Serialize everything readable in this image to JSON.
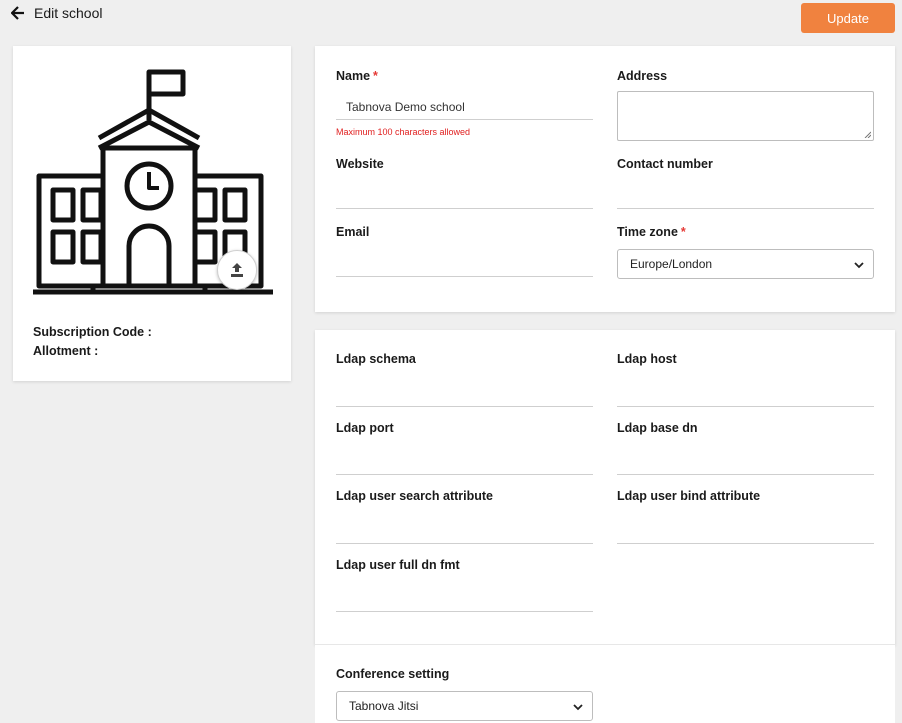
{
  "header": {
    "title": "Edit school",
    "update_label": "Update"
  },
  "profile": {
    "subscription_label": "Subscription Code :",
    "subscription_value": "",
    "allotment_label": "Allotment :",
    "allotment_value": ""
  },
  "general": {
    "name_label": "Name",
    "name_value": "Tabnova Demo school",
    "name_hint": "Maximum 100 characters allowed",
    "address_label": "Address",
    "address_value": "",
    "website_label": "Website",
    "website_value": "",
    "contact_label": "Contact number",
    "contact_value": "",
    "email_label": "Email",
    "email_value": "",
    "timezone_label": "Time zone",
    "timezone_value": "Europe/London",
    "required_mark": "*"
  },
  "ldap": {
    "schema_label": "Ldap schema",
    "host_label": "Ldap host",
    "port_label": "Ldap port",
    "base_dn_label": "Ldap base dn",
    "search_attr_label": "Ldap user search attribute",
    "bind_attr_label": "Ldap user bind attribute",
    "full_dn_label": "Ldap user full dn fmt"
  },
  "conference": {
    "label": "Conference setting",
    "value": "Tabnova Jitsi"
  },
  "colors": {
    "accent": "#f0823f",
    "required": "#e53935",
    "hint": "#e02020"
  },
  "icons": {
    "back": "arrow-left-icon",
    "upload": "upload-icon",
    "chevron": "chevron-down-icon",
    "school": "school-building-icon"
  }
}
